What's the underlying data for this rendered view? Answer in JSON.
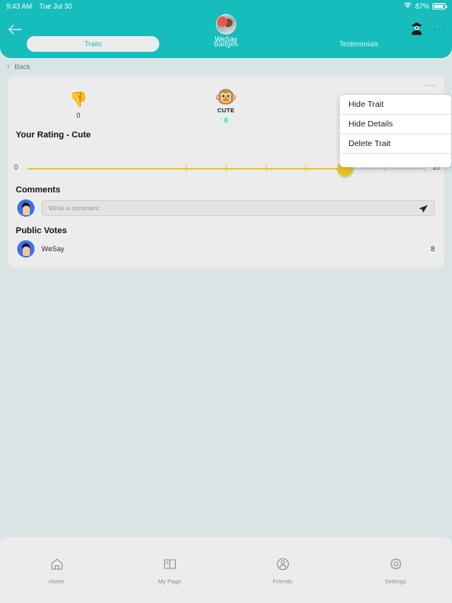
{
  "statusbar": {
    "time": "9:43 AM",
    "date": "Tue Jul 30",
    "battery_percent": "87%",
    "wifi_icon": "wifi-icon",
    "battery_icon": "battery-icon"
  },
  "header": {
    "back_icon": "arrow-left-icon",
    "brand_name": "WeSay",
    "avatar": "profile-avatar",
    "spy_icon": "detective-icon",
    "overflow_icon": "ellipsis-icon",
    "accent_color": "#17bdbd",
    "tabs": [
      {
        "label": "Traits",
        "active": true
      },
      {
        "label": "Badges",
        "active": false
      },
      {
        "label": "Testimonials",
        "active": false
      }
    ]
  },
  "backbar": {
    "chevron_icon": "chevron-left-icon",
    "label": "Back"
  },
  "card": {
    "overflow_icon": "ellipsis-icon",
    "dislike": {
      "icon": "thumbs-down-icon",
      "count": "0"
    },
    "trait": {
      "icon": "teddy-bear-icon",
      "name": "CUTE",
      "score": "8",
      "score_color": "#2ba7a7"
    },
    "rating": {
      "title": "Your Rating - Cute",
      "value": "8",
      "min_label": "0",
      "max_label": "10",
      "min": 0,
      "max": 10,
      "fill_color": "#e9c22e",
      "thumb_color": "#e8c52e"
    },
    "comments": {
      "title": "Comments",
      "avatar": "user-avatar",
      "input_value": "",
      "input_placeholder": "Write a comment",
      "send_icon": "send-icon"
    },
    "public_votes": {
      "title": "Public Votes",
      "rows": [
        {
          "avatar": "user-avatar",
          "name": "WeSay",
          "score": "8"
        }
      ]
    }
  },
  "menu": {
    "items": [
      {
        "label": "Hide Trait"
      },
      {
        "label": "Hide Details"
      },
      {
        "label": "Delete Trait"
      }
    ]
  },
  "tabbar": {
    "items": [
      {
        "label": "Home",
        "icon": "home-icon"
      },
      {
        "label": "My Page",
        "icon": "book-icon"
      },
      {
        "label": "Friends",
        "icon": "friends-icon"
      },
      {
        "label": "Settings",
        "icon": "gear-icon"
      }
    ]
  }
}
